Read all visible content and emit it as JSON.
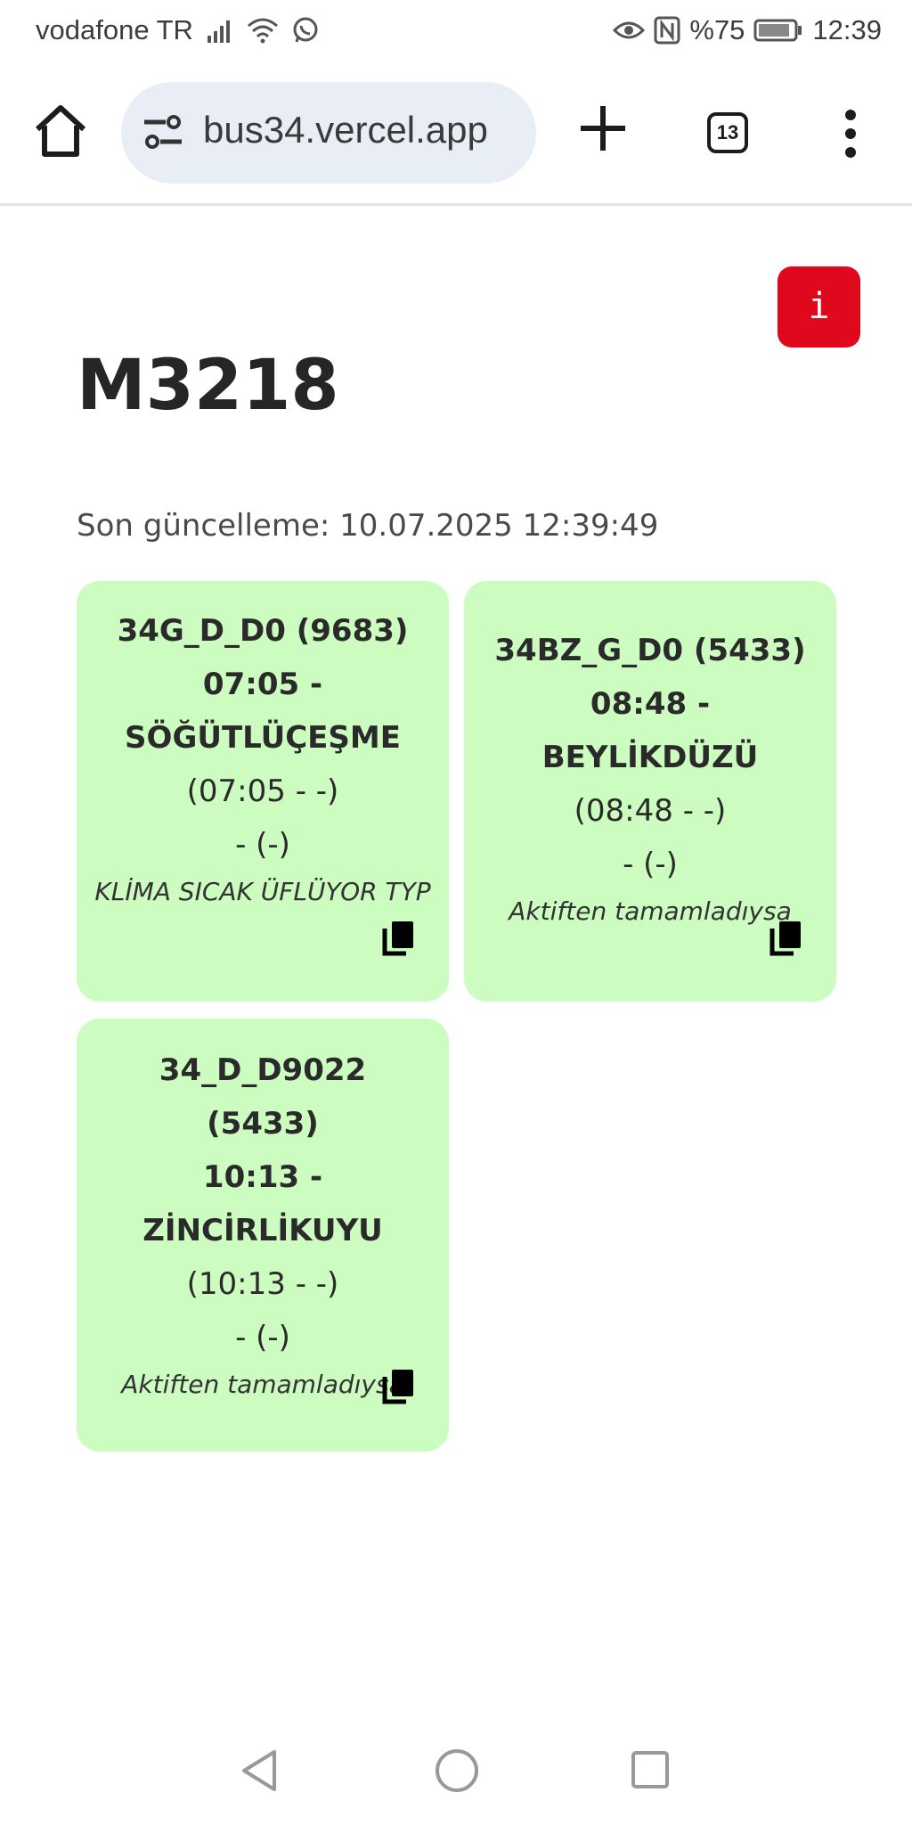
{
  "status_bar": {
    "carrier": "vodafone TR",
    "battery": "%75",
    "time": "12:39"
  },
  "browser": {
    "url": "bus34.vercel.app",
    "tab_count": "13"
  },
  "page": {
    "info_label": "i",
    "title": "M3218",
    "last_update": "Son güncelleme: 10.07.2025 12:39:49",
    "card_color": "#ccfcc0",
    "info_color": "#e0081d",
    "cards": [
      {
        "route_lines": [
          "34G_D_D0 (9683)",
          "07:05 -",
          "SÖĞÜTLÜÇEŞME"
        ],
        "time_range": "(07:05 - -)",
        "extra": "- (-)",
        "note": "KLİMA SICAK ÜFLÜYOR TYP"
      },
      {
        "route_lines": [
          "34BZ_G_D0 (5433)",
          "08:48 -",
          "BEYLİKDÜZÜ"
        ],
        "time_range": "(08:48 - -)",
        "extra": "- (-)",
        "note": "Aktiften tamamladıysa"
      },
      {
        "route_lines": [
          "34_D_D9022",
          "(5433)",
          "10:13 -",
          "ZİNCİRLİKUYU"
        ],
        "time_range": "(10:13 - -)",
        "extra": "- (-)",
        "note": "Aktiften tamamladıysa"
      }
    ]
  }
}
